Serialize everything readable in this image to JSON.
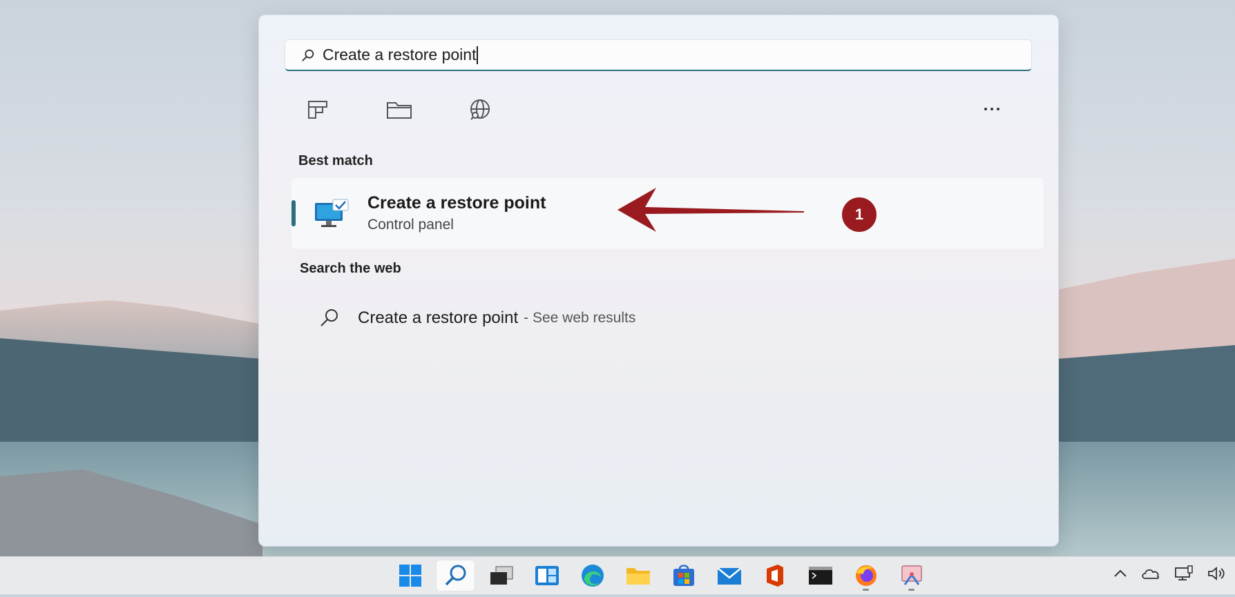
{
  "search": {
    "query": "Create a restore point"
  },
  "filters": [
    {
      "icon": "apps-icon"
    },
    {
      "icon": "documents-icon"
    },
    {
      "icon": "web-icon"
    }
  ],
  "more_icon": "more-options-icon",
  "best_match": {
    "section_label": "Best match",
    "title": "Create a restore point",
    "subtitle": "Control panel",
    "icon": "system-restore-icon"
  },
  "web": {
    "section_label": "Search the web",
    "title": "Create a restore point",
    "suffix": "- See web results"
  },
  "annotation": {
    "badge": "1",
    "color": "#9a1b1f"
  },
  "colors": {
    "accent": "#2b6f7f"
  },
  "taskbar": {
    "icons": [
      "windows-start-icon",
      "search-icon",
      "task-view-icon",
      "widgets-icon",
      "edge-icon",
      "file-explorer-icon",
      "store-icon",
      "mail-icon",
      "office-icon",
      "terminal-icon",
      "firefox-icon",
      "snipping-icon"
    ],
    "tray": [
      "chevron-up-icon",
      "onedrive-icon",
      "network-icon",
      "volume-icon"
    ]
  }
}
